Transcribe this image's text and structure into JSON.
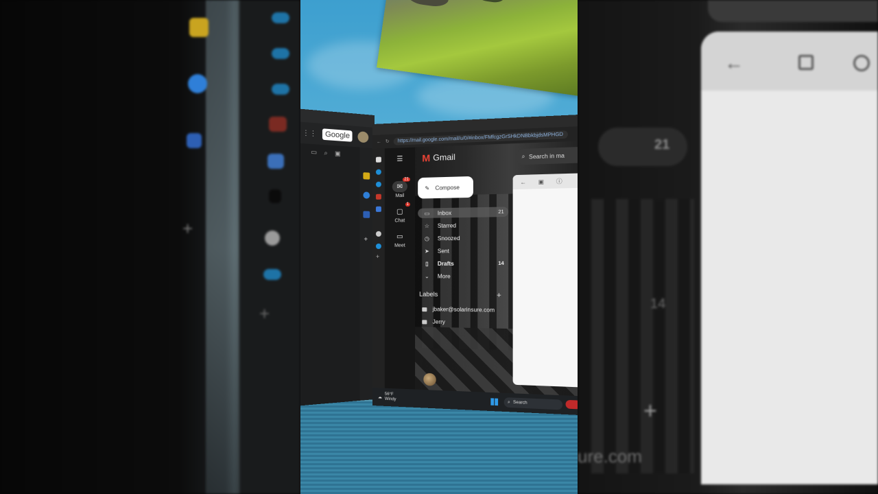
{
  "left_window": {
    "google_label": "Google"
  },
  "browser": {
    "url": "https://mail.google.com/mail/u/0/#inbox/FMfcgzGrSHkDNBbkbjdsMPHGD"
  },
  "rail": {
    "mail_label": "Mail",
    "mail_badge": "21",
    "chat_label": "Chat",
    "chat_badge": "1",
    "meet_label": "Meet"
  },
  "gmail": {
    "brand": "Gmail",
    "compose_label": "Compose",
    "search_placeholder": "Search in ma",
    "nav": [
      {
        "label": "Inbox",
        "count": "21",
        "icon": "inbox-icon"
      },
      {
        "label": "Starred",
        "count": "",
        "icon": "star-icon"
      },
      {
        "label": "Snoozed",
        "count": "",
        "icon": "clock-icon"
      },
      {
        "label": "Sent",
        "count": "",
        "icon": "send-icon"
      },
      {
        "label": "Drafts",
        "count": "14",
        "icon": "draft-icon"
      },
      {
        "label": "More",
        "count": "",
        "icon": "chevron-down-icon"
      }
    ],
    "labels_heading": "Labels",
    "labels": [
      "jbaker@solarinsure.com",
      "Jerry"
    ]
  },
  "taskbar": {
    "temperature": "56°F",
    "condition": "Windy",
    "search_label": "Search"
  },
  "background_right": {
    "badge_count": "21",
    "drafts_count": "14",
    "domain_fragment": "ure.com"
  },
  "colors": {
    "sky": "#59b1d8",
    "gmail_red": "#ea4335",
    "badge_red": "#d93025",
    "windows_blue": "#2f9ae8"
  }
}
